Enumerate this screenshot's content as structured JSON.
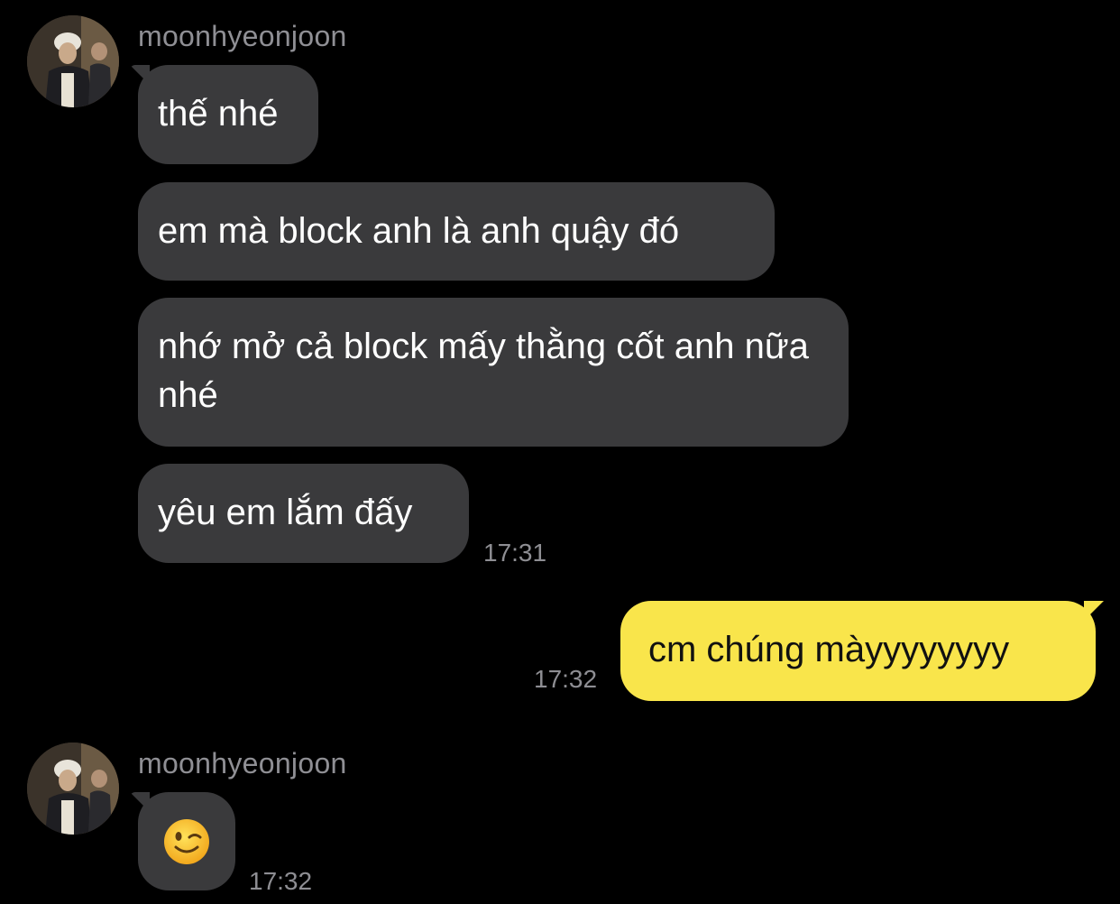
{
  "messages": {
    "group1": {
      "sender": "moonhyeonjoon",
      "bubbles": [
        "thế nhé",
        "em mà block anh là anh quậy đó",
        "nhớ mở cả block mấy thằng cốt anh nữa nhé",
        "yêu em lắm đấy"
      ],
      "time": "17:31"
    },
    "outgoing": {
      "text": "cm chúng màyyyyyyyy",
      "time": "17:32"
    },
    "group2": {
      "sender": "moonhyeonjoon",
      "emoji": "winking-face",
      "time": "17:32"
    }
  },
  "colors": {
    "background": "#000000",
    "incoming_bubble": "#3a3a3c",
    "outgoing_bubble": "#f9e54b",
    "meta_text": "#8e8e93"
  }
}
